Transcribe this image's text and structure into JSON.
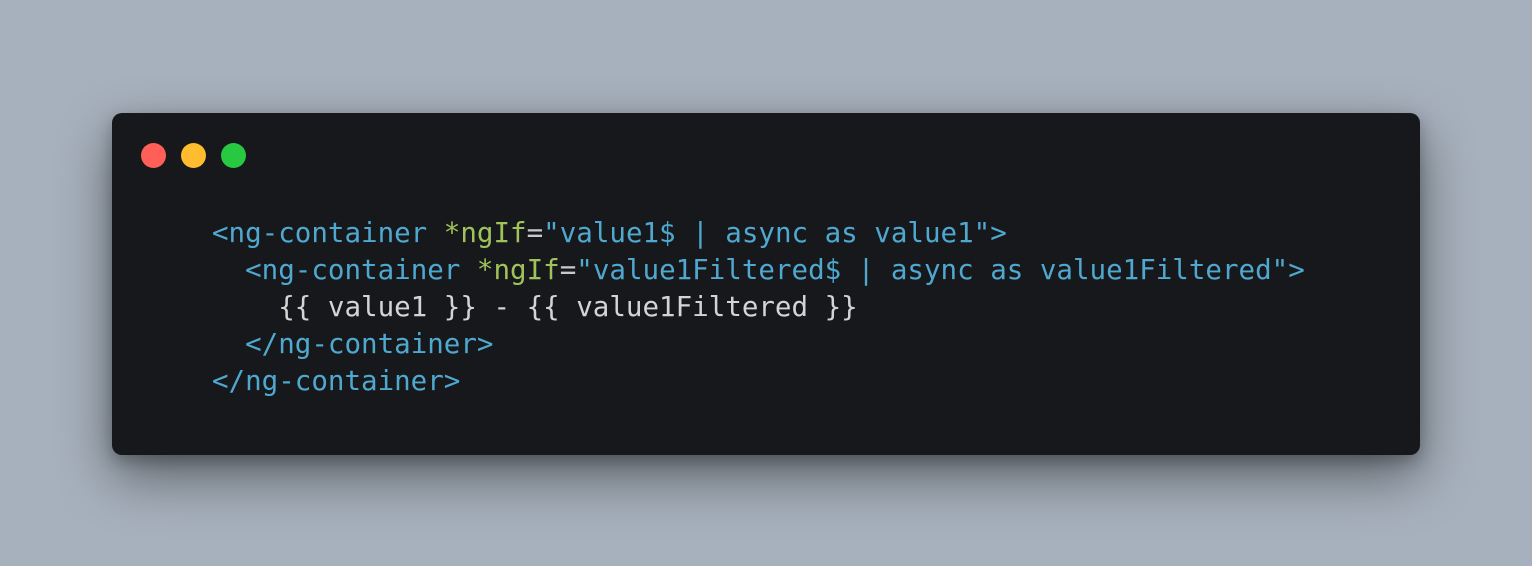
{
  "colors": {
    "background": "#a7b1bd",
    "window": "#17181b",
    "tag": "#4fa8cf",
    "attribute": "#a0c25a",
    "punctuation": "#c8c8c8",
    "string": "#4fa8cf",
    "text": "#d4d4d4",
    "close_dot": "#ff5f57",
    "minimize_dot": "#febc2e",
    "maximize_dot": "#28c840"
  },
  "window_controls": {
    "close": "close-dot",
    "minimize": "minimize-dot",
    "maximize": "maximize-dot"
  },
  "code": {
    "line1": {
      "indent": "",
      "tag_open": "<ng-container ",
      "attr": "*ngIf",
      "eq": "=",
      "value": "\"value1$ | async as value1\"",
      "close": ">"
    },
    "line2": {
      "indent": "  ",
      "tag_open": "<ng-container ",
      "attr": "*ngIf",
      "eq": "=",
      "value": "\"value1Filtered$ | async as value1Filtered\"",
      "close": ">"
    },
    "line3": {
      "indent": "    ",
      "text": "{{ value1 }} - {{ value1Filtered }}"
    },
    "line4": {
      "indent": "  ",
      "tag_close": "</ng-container>"
    },
    "line5": {
      "indent": "",
      "tag_close": "</ng-container>"
    }
  }
}
